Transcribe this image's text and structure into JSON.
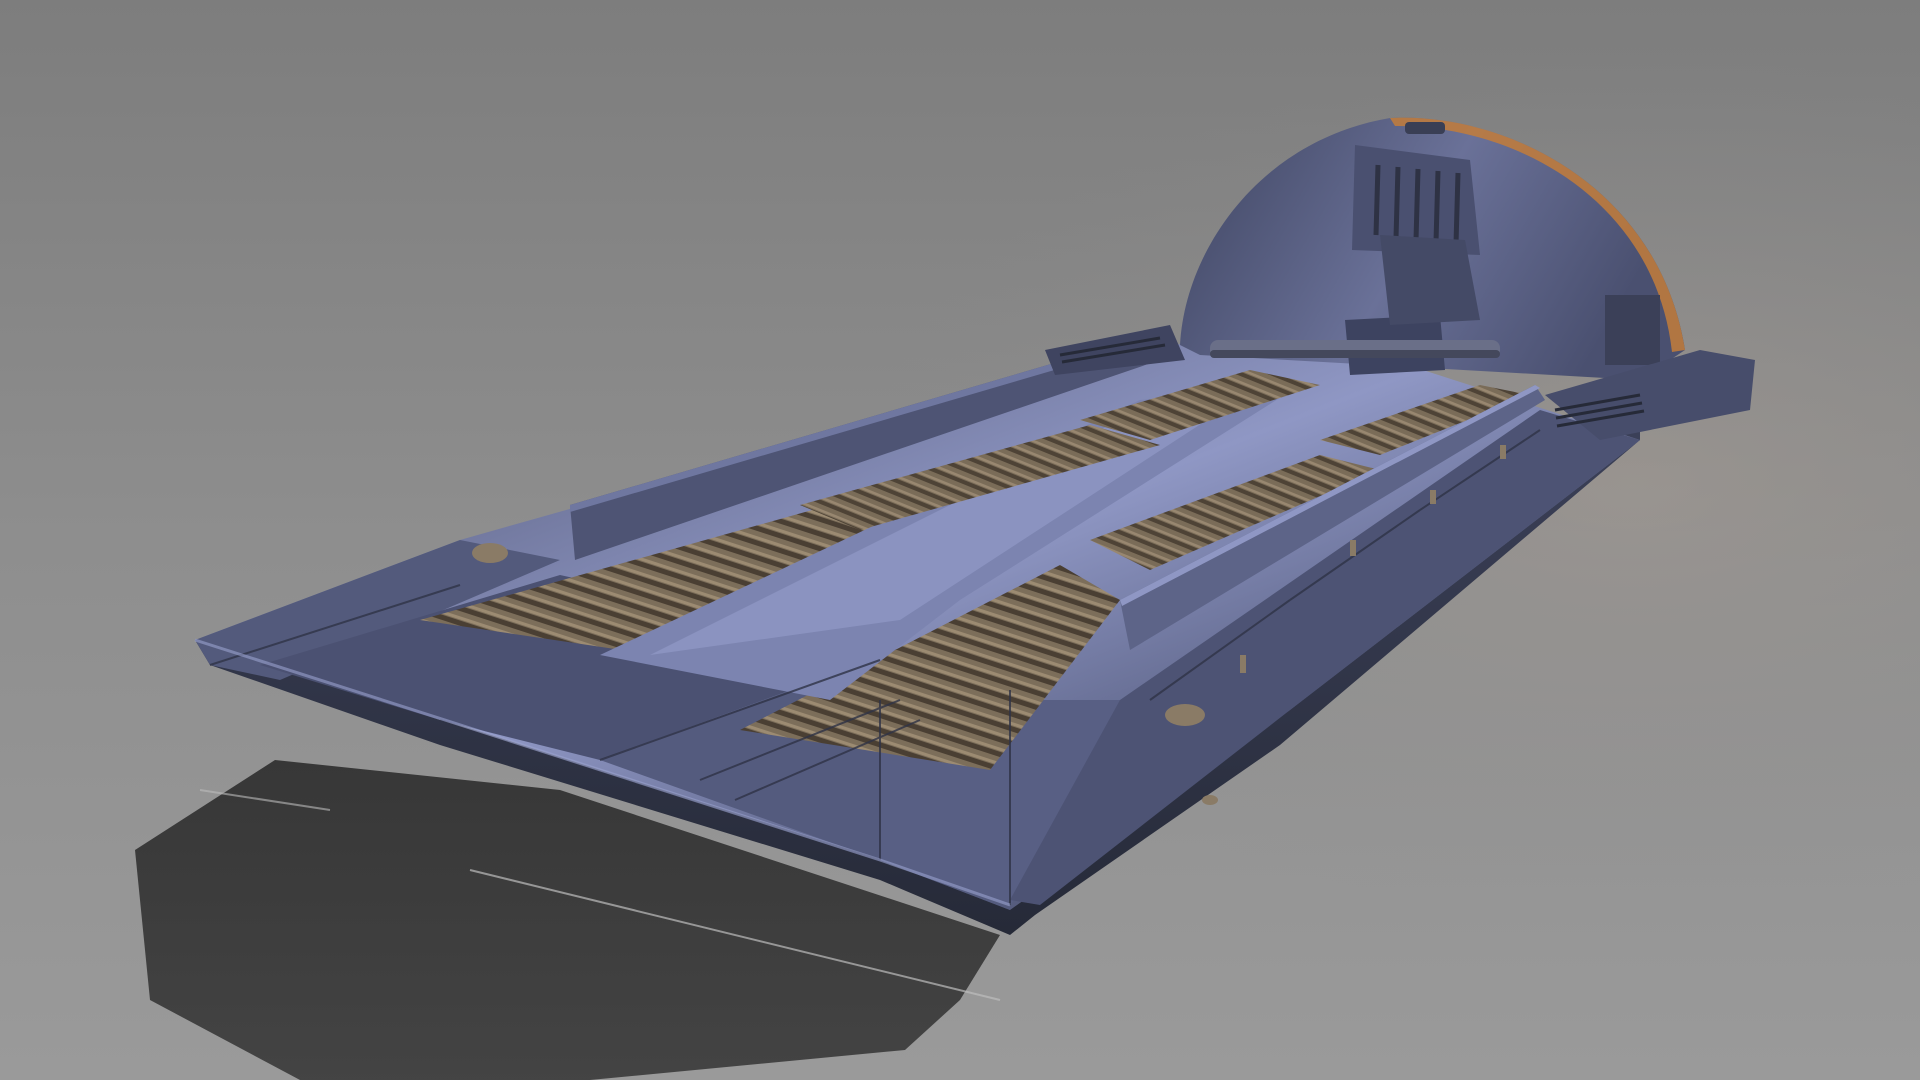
{
  "scene": {
    "subject": "hover-sled",
    "colors": {
      "background_top": "#7d7d7d",
      "background_bottom": "#9a9a9a",
      "hull_light": "#8c93b8",
      "hull_mid": "#5a6082",
      "hull_dark": "#3a3f55",
      "hull_shadow": "#2a2e3d",
      "slats_light": "#8a7b66",
      "slats_dark": "#4a3f33",
      "accent_orange": "#d88a3a",
      "ground_shadow": "#3a3a3a"
    }
  }
}
